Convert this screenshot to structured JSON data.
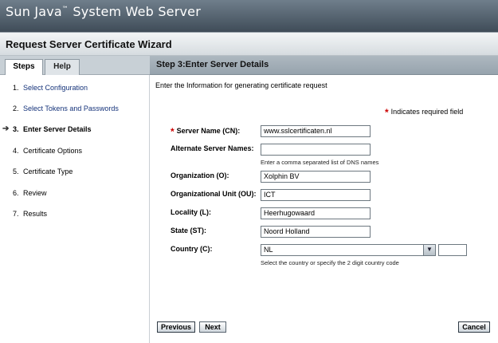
{
  "app": {
    "brand": "Sun Java",
    "brand_tm": "™",
    "brand_rest": " System Web Server"
  },
  "wizard": {
    "title": "Request Server Certificate Wizard"
  },
  "tabs": [
    {
      "label": "Steps"
    },
    {
      "label": "Help"
    }
  ],
  "steps": [
    {
      "num": "1.",
      "label": "Select Configuration"
    },
    {
      "num": "2.",
      "label": "Select Tokens and Passwords"
    },
    {
      "num": "3.",
      "label": "Enter Server Details"
    },
    {
      "num": "4.",
      "label": "Certificate Options"
    },
    {
      "num": "5.",
      "label": "Certificate Type"
    },
    {
      "num": "6.",
      "label": "Review"
    },
    {
      "num": "7.",
      "label": "Results"
    }
  ],
  "current_step_arrow": "➔",
  "main": {
    "heading": "Step 3:Enter Server Details",
    "instruction": "Enter the Information for generating certificate request",
    "required_star": "*",
    "required_note": "Indicates required field"
  },
  "form": {
    "server_name": {
      "label": "Server Name (CN):",
      "value": "www.sslcertificaten.nl"
    },
    "alt_names": {
      "label": "Alternate Server Names:",
      "value": "",
      "help": "Enter a comma separated list of DNS names"
    },
    "organization": {
      "label": "Organization (O):",
      "value": "Xolphin BV"
    },
    "org_unit": {
      "label": "Organizational Unit (OU):",
      "value": "ICT"
    },
    "locality": {
      "label": "Locality (L):",
      "value": "Heerhugowaard"
    },
    "state": {
      "label": "State (ST):",
      "value": "Noord Holland"
    },
    "country": {
      "label": "Country (C):",
      "selected": "NL",
      "code": "",
      "help": "Select the country or specify the 2 digit country code"
    }
  },
  "buttons": {
    "previous": "Previous",
    "next": "Next",
    "cancel": "Cancel"
  },
  "colors": {
    "header_dark": "#3f4c58",
    "link": "#15337a",
    "required": "#cc0000"
  }
}
